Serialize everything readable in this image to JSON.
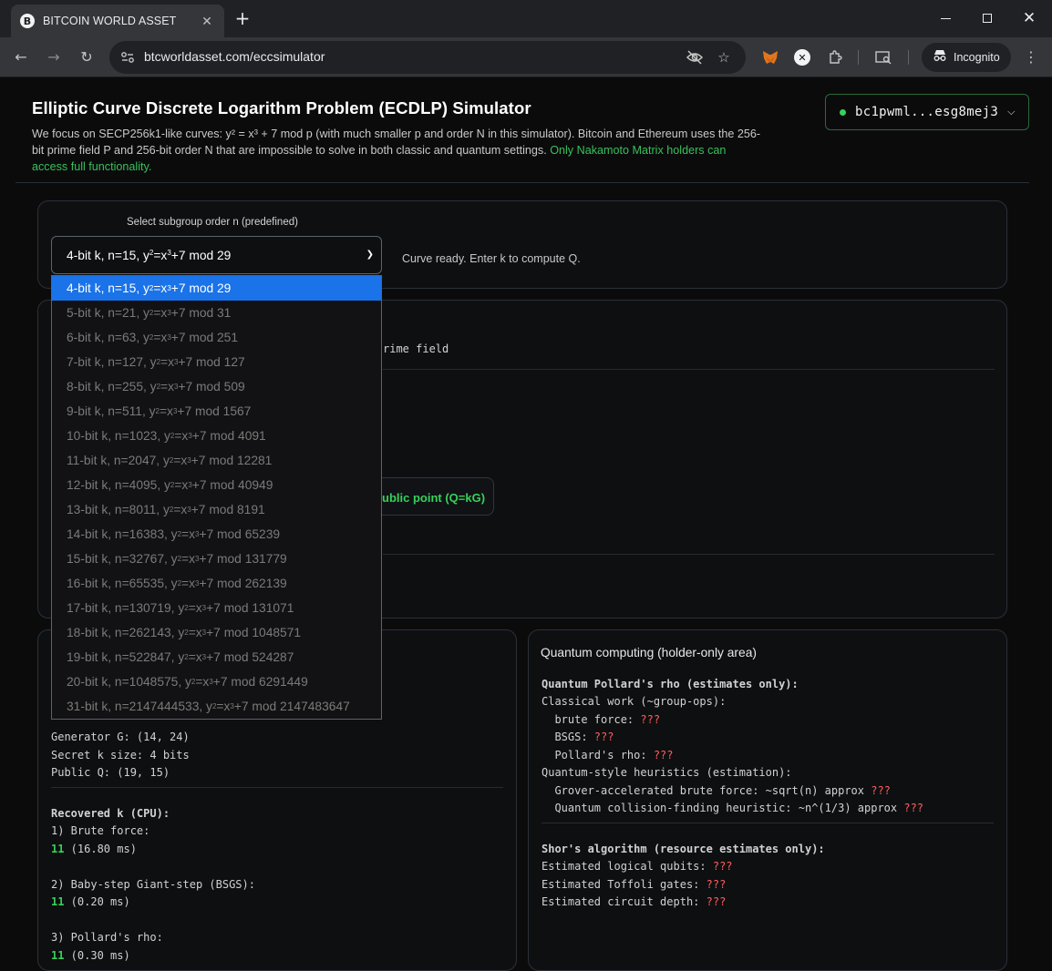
{
  "browser": {
    "tab_title": "BITCOIN WORLD ASSET",
    "tab_favicon": "B",
    "url": "btcworldasset.com/eccsimulator",
    "incognito_label": "Incognito"
  },
  "header": {
    "title": "Elliptic Curve Discrete Logarithm Problem (ECDLP) Simulator",
    "description_part1": "We focus on SECP256k1-like curves: y² = x³ + 7 mod p (with much smaller p and order N in this simulator). Bitcoin and Ethereum uses the 256-bit prime field P and 256-bit order N that are impossible to solve in both classic and quantum settings. ",
    "description_highlight": "Only Nakamoto Matrix holders can access full functionality.",
    "wallet_address": "bc1pwml...esg8mej3"
  },
  "curve_selector": {
    "label": "Select subgroup order n (predefined)",
    "selected_prefix": "4-bit k, n=15, y",
    "selected_mid": "=x",
    "selected_suffix": "+7 mod 29",
    "status": "Curve ready. Enter k to compute Q.",
    "options": [
      {
        "pre": "4-bit k, n=15, y",
        "mid": "=x",
        "post": "+7 mod 29"
      },
      {
        "pre": "5-bit k, n=21, y",
        "mid": "=x",
        "post": "+7 mod 31"
      },
      {
        "pre": "6-bit k, n=63, y",
        "mid": "=x",
        "post": "+7 mod 251"
      },
      {
        "pre": "7-bit k, n=127, y",
        "mid": "=x",
        "post": "+7 mod 127"
      },
      {
        "pre": "8-bit k, n=255, y",
        "mid": "=x",
        "post": "+7 mod 509"
      },
      {
        "pre": "9-bit k, n=511, y",
        "mid": "=x",
        "post": "+7 mod 1567"
      },
      {
        "pre": "10-bit k, n=1023, y",
        "mid": "=x",
        "post": "+7 mod 4091"
      },
      {
        "pre": "11-bit k, n=2047, y",
        "mid": "=x",
        "post": "+7 mod 12281"
      },
      {
        "pre": "12-bit k, n=4095, y",
        "mid": "=x",
        "post": "+7 mod 40949"
      },
      {
        "pre": "13-bit k, n=8011, y",
        "mid": "=x",
        "post": "+7 mod 8191"
      },
      {
        "pre": "14-bit k, n=16383, y",
        "mid": "=x",
        "post": "+7 mod 65239"
      },
      {
        "pre": "15-bit k, n=32767, y",
        "mid": "=x",
        "post": "+7 mod 131779"
      },
      {
        "pre": "16-bit k, n=65535, y",
        "mid": "=x",
        "post": "+7 mod 262139"
      },
      {
        "pre": "17-bit k, n=130719, y",
        "mid": "=x",
        "post": "+7 mod 131071"
      },
      {
        "pre": "18-bit k, n=262143, y",
        "mid": "=x",
        "post": "+7 mod 1048571"
      },
      {
        "pre": "19-bit k, n=522847, y",
        "mid": "=x",
        "post": "+7 mod 524287"
      },
      {
        "pre": "20-bit k, n=1048575, y",
        "mid": "=x",
        "post": "+7 mod 6291449"
      },
      {
        "pre": "31-bit k, n=2147444533, y",
        "mid": "=x",
        "post": "+7 mod 2147483647"
      }
    ]
  },
  "keygen": {
    "prime_field_fragment": "rime field",
    "compute_button_fragment": "ublic point (Q=kG)"
  },
  "classical": {
    "generator": "Generator G: (14, 24)",
    "secret_size": "Secret k size: 4 bits",
    "public_q": "Public Q: (19, 15)",
    "recovered_heading": "Recovered k (CPU):",
    "brute_label": "1) Brute force:",
    "brute_value": "11",
    "brute_time": " (16.80 ms)",
    "bsgs_label": "2) Baby-step Giant-step (BSGS):",
    "bsgs_value": "11",
    "bsgs_time": " (0.20 ms)",
    "rho_label": "3) Pollard's rho:",
    "rho_value": "11",
    "rho_time": " (0.30 ms)"
  },
  "quantum": {
    "title": "Quantum computing (holder-only area)",
    "rho_heading": "Quantum Pollard's rho (estimates only):",
    "classical_work": "Classical work (~group-ops):",
    "brute_force": "  brute force: ",
    "bsgs": "  BSGS: ",
    "pollard": "  Pollard's rho: ",
    "heuristics": "Quantum-style heuristics (estimation):",
    "grover": "  Grover-accelerated brute force: ~sqrt(n) approx ",
    "collision": "  Quantum collision-finding heuristic: ~n^(1/3) approx ",
    "shor_heading": "Shor's algorithm (resource estimates only):",
    "qubits": "Estimated logical qubits: ",
    "toffoli": "Estimated Toffoli gates: ",
    "depth": "Estimated circuit depth: ",
    "unknown": "???"
  },
  "colors": {
    "accent_green": "#36d15a",
    "unknown_red": "#ff5d5d",
    "selected_blue": "#1a73e8"
  }
}
